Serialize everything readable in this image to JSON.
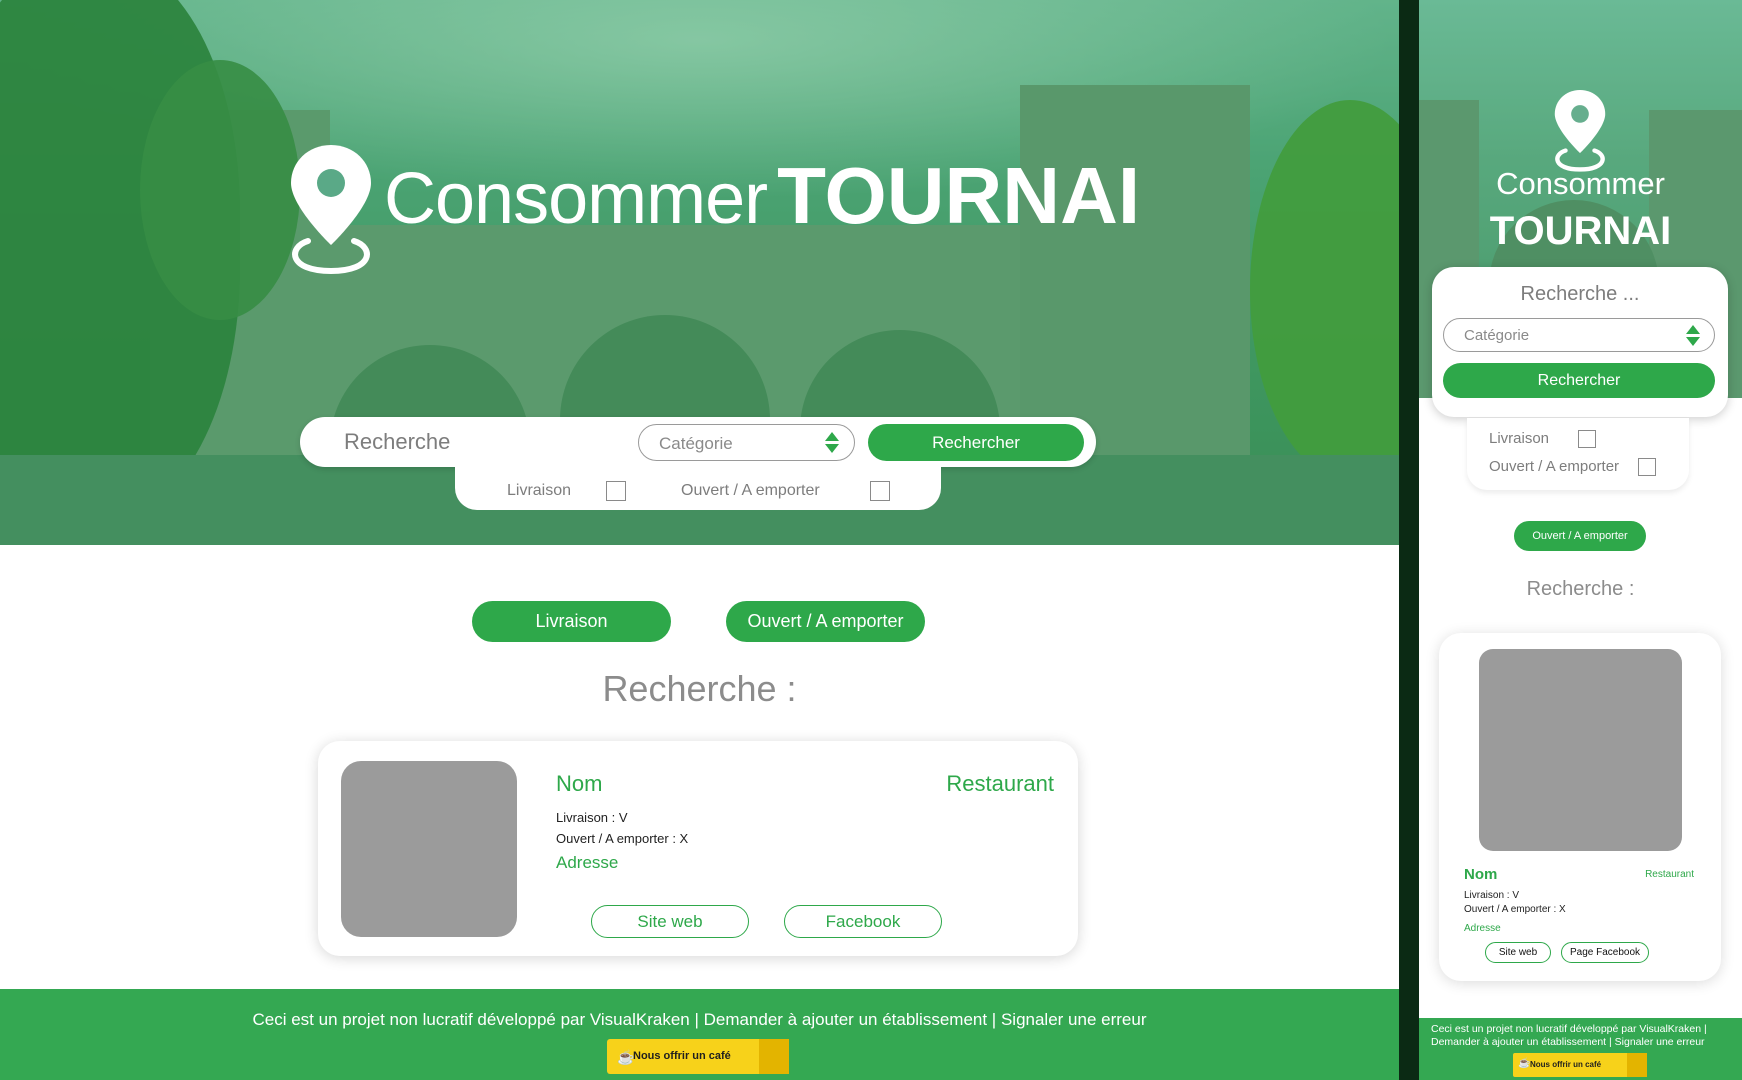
{
  "colors": {
    "primary_green": "#2ea84a",
    "footer_green": "#34a852",
    "coffee_yellow": "#f7d21a"
  },
  "brand": {
    "light": "Consommer",
    "bold": "TOURNAI"
  },
  "search": {
    "placeholder": "Recherche",
    "category": "Catégorie",
    "button": "Rechercher"
  },
  "filters": {
    "delivery": "Livraison",
    "open_takeaway": "Ouvert / A emporter"
  },
  "filter_pills": {
    "delivery": "Livraison",
    "open_takeaway": "Ouvert / A emporter"
  },
  "results": {
    "title": "Recherche :"
  },
  "card": {
    "name": "Nom",
    "type": "Restaurant",
    "delivery_line": "Livraison :  V",
    "open_line": "Ouvert / A emporter :  X",
    "address": "Adresse",
    "website": "Site web",
    "facebook": "Facebook"
  },
  "footer": {
    "text": "Ceci est un projet non lucratif développé par VisualKraken | Demander à ajouter un établissement | Signaler une erreur",
    "coffee": "Nous offrir un café"
  },
  "mobile": {
    "brand_light": "Consommer",
    "brand_bold": "TOURNAI",
    "search_placeholder": "Recherche ...",
    "category": "Catégorie",
    "button": "Rechercher",
    "filter_delivery": "Livraison",
    "filter_open": "Ouvert / A emporter",
    "pill": "Ouvert / A emporter",
    "results_title": "Recherche :",
    "card": {
      "name": "Nom",
      "type": "Restaurant",
      "delivery_line": "Livraison : V",
      "open_line": "Ouvert / A emporter : X",
      "address": "Adresse",
      "website": "Site web",
      "facebook": "Page Facebook"
    },
    "footer_line1": "Ceci est un projet non lucratif développé par VisualKraken |",
    "footer_line2": "Demander à ajouter un établissement | Signaler une erreur",
    "coffee": "Nous offrir un café"
  }
}
